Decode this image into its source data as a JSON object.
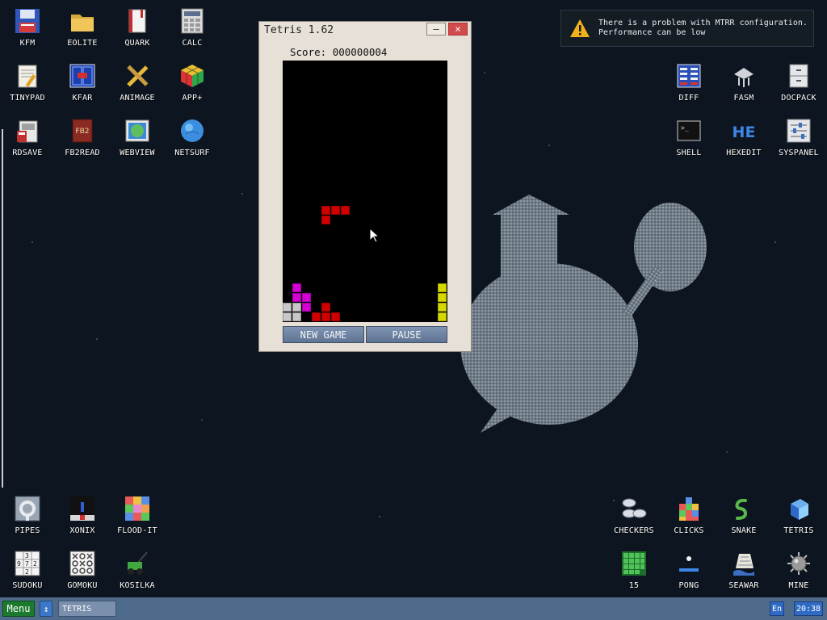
{
  "desktop": {
    "icons": [
      {
        "label": "KFM",
        "icon": "floppy-disk-icon"
      },
      {
        "label": "EOLITE",
        "icon": "folder-icon"
      },
      {
        "label": "QUARK",
        "icon": "book-icon"
      },
      {
        "label": "CALC",
        "icon": "calculator-icon"
      },
      {
        "label": "TINYPAD",
        "icon": "notepad-icon"
      },
      {
        "label": "KFAR",
        "icon": "kfar-icon"
      },
      {
        "label": "ANIMAGE",
        "icon": "pencil-ruler-icon"
      },
      {
        "label": "APP+",
        "icon": "cube-icon"
      },
      {
        "label": "RDSAVE",
        "icon": "disk-save-icon"
      },
      {
        "label": "FB2READ",
        "icon": "fb2-book-icon"
      },
      {
        "label": "WEBVIEW",
        "icon": "webview-icon"
      },
      {
        "label": "NETSURF",
        "icon": "globe-icon"
      },
      {
        "label": "DIFF",
        "icon": "diff-icon"
      },
      {
        "label": "FASM",
        "icon": "fasm-icon"
      },
      {
        "label": "DOCPACK",
        "icon": "cabinet-icon"
      },
      {
        "label": "SHELL",
        "icon": "terminal-icon"
      },
      {
        "label": "HEXEDIT",
        "icon": "hex-icon"
      },
      {
        "label": "SYSPANEL",
        "icon": "sliders-icon"
      },
      {
        "label": "PIPES",
        "icon": "pipes-icon"
      },
      {
        "label": "XONIX",
        "icon": "xonix-icon"
      },
      {
        "label": "FLOOD-IT",
        "icon": "color-grid-icon"
      },
      {
        "label": "SUDOKU",
        "icon": "sudoku-icon"
      },
      {
        "label": "GOMOKU",
        "icon": "gomoku-icon"
      },
      {
        "label": "KOSILKA",
        "icon": "lawnmower-icon"
      },
      {
        "label": "CHECKERS",
        "icon": "checkers-icon"
      },
      {
        "label": "CLICKS",
        "icon": "clicks-icon"
      },
      {
        "label": "SNAKE",
        "icon": "snake-icon"
      },
      {
        "label": "TETRIS",
        "icon": "tetris-icon"
      },
      {
        "label": "15",
        "icon": "fifteen-puzzle-icon"
      },
      {
        "label": "PONG",
        "icon": "pong-icon"
      },
      {
        "label": "SEAWAR",
        "icon": "seawar-icon"
      },
      {
        "label": "MINE",
        "icon": "mine-icon"
      }
    ]
  },
  "window": {
    "title": "Tetris 1.62",
    "score_label": "Score:",
    "score_value": "000000004",
    "new_game_label": "NEW GAME",
    "pause_label": "PAUSE"
  },
  "notification": {
    "line1": "There is a problem with MTRR configuration.",
    "line2": "Performance can be low"
  },
  "taskbar": {
    "menu_label": "Menu",
    "task_label": "TETRIS",
    "lang": "En",
    "clock": "20:38"
  },
  "colors": {
    "red": "#d10000",
    "magenta": "#d400d4",
    "yellow": "#d8d800",
    "grey": "#c8c8c8"
  }
}
